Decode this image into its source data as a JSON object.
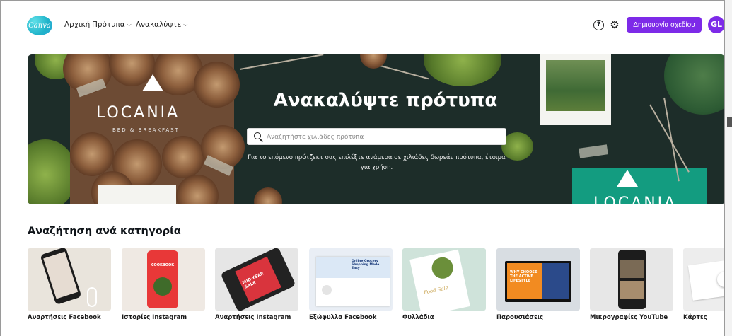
{
  "header": {
    "logo_text": "Canva",
    "nav": [
      {
        "label": "Αρχική"
      },
      {
        "label": "Πρότυπα"
      },
      {
        "label": "Ανακαλύψτε"
      }
    ],
    "create_button": "Δημιουργία σχεδίου",
    "avatar_initials": "GL"
  },
  "hero": {
    "title": "Ανακαλύψτε πρότυπα",
    "search_placeholder": "Αναζητήστε χιλιάδες πρότυπα",
    "subtitle": "Για το επόμενο πρότζεκτ σας επιλέξτε ανάμεσα σε χιλιάδες δωρεάν πρότυπα, έτοιμα για χρήση.",
    "brand_left": "LOCANIA",
    "brand_left_sub": "BED & BREAKFAST",
    "brand_right": "LOCANIA"
  },
  "categories": {
    "title": "Αναζήτηση ανά κατηγορία",
    "items": [
      {
        "label": "Αναρτήσεις Facebook"
      },
      {
        "label": "Ιστορίες Instagram",
        "thumb_text": "COOKBOOK"
      },
      {
        "label": "Αναρτήσεις Instagram",
        "thumb_text": "MID-YEAR SALE"
      },
      {
        "label": "Εξώφυλλα Facebook",
        "thumb_text": "Online Grocery Shopping Made Easy"
      },
      {
        "label": "Φυλλάδια",
        "thumb_text": "Food Sale"
      },
      {
        "label": "Παρουσιάσεις",
        "thumb_text": "WHY CHOOSE THE ACTIVE LIFESTYLE"
      },
      {
        "label": "Μικρογραφίες YouTube"
      },
      {
        "label": "Κάρτες"
      }
    ]
  },
  "colors": {
    "accent": "#7d2ae8",
    "hero_bg": "#1d2d29",
    "locania_green": "#139c80"
  }
}
